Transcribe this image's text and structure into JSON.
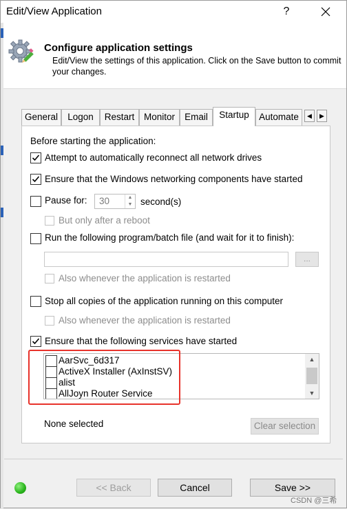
{
  "window": {
    "title": "Edit/View Application",
    "help_label": "?"
  },
  "header": {
    "title": "Configure application settings",
    "description": "Edit/View the settings of this application. Click on the Save button to commit your changes."
  },
  "tabs": [
    {
      "label": "General"
    },
    {
      "label": "Logon"
    },
    {
      "label": "Restart"
    },
    {
      "label": "Monitor"
    },
    {
      "label": "Email"
    },
    {
      "label": "Startup",
      "active": true
    },
    {
      "label": "Automate"
    }
  ],
  "startup": {
    "before_label": "Before starting the application:",
    "reconnect_drives": {
      "label": "Attempt to automatically reconnect all network drives",
      "checked": true
    },
    "ensure_networking": {
      "label": "Ensure that the Windows networking components have started",
      "checked": true
    },
    "pause": {
      "label": "Pause for:",
      "checked": false,
      "value": "30",
      "unit": "second(s)"
    },
    "after_reboot": {
      "label": "But only after a reboot",
      "checked": false,
      "enabled": false
    },
    "run_program": {
      "label": "Run the following program/batch file (and wait for it to finish):",
      "checked": false
    },
    "program_path": "",
    "browse_label": "...",
    "run_on_restart": {
      "label": "Also whenever the application is restarted",
      "checked": false,
      "enabled": false
    },
    "stop_copies": {
      "label": "Stop all copies of the application running on this computer",
      "checked": false
    },
    "stop_on_restart": {
      "label": "Also whenever the application is restarted",
      "checked": false,
      "enabled": false
    },
    "ensure_services": {
      "label": "Ensure that the following services have started",
      "checked": true
    },
    "services": [
      {
        "name": "AarSvc_6d317",
        "checked": false
      },
      {
        "name": "ActiveX Installer (AxInstSV)",
        "checked": false
      },
      {
        "name": "alist",
        "checked": false
      },
      {
        "name": "AllJoyn Router Service",
        "checked": false
      }
    ],
    "selection_status": "None selected",
    "clear_label": "Clear selection"
  },
  "footer": {
    "back_label": "<< Back",
    "cancel_label": "Cancel",
    "save_label": "Save >>"
  },
  "watermark": "CSDN @三希",
  "colors": {
    "highlight": "#e8322a",
    "status": "#28b31b",
    "accent": "#2b62b8"
  }
}
